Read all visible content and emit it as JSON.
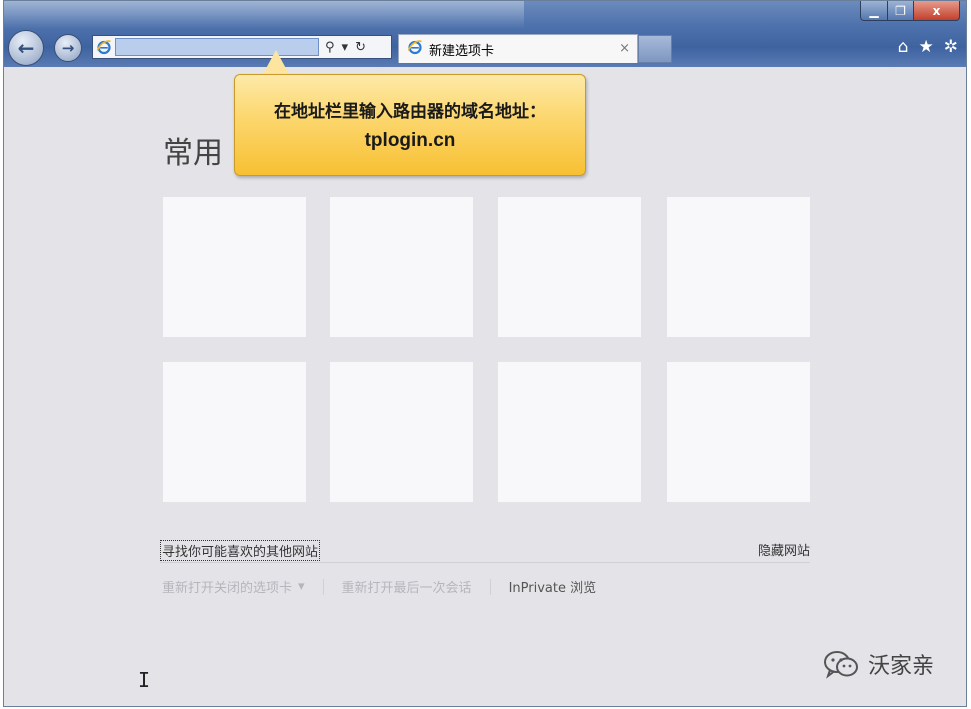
{
  "window": {
    "controls": {
      "minimize": "▁",
      "maximize": "❐",
      "close": "x"
    }
  },
  "nav": {
    "back_icon": "←",
    "forward_icon": "→"
  },
  "address": {
    "value": "",
    "search_icon": "⚲",
    "dropdown_icon": "▾",
    "refresh_icon": "↻"
  },
  "tab": {
    "label": "新建选项卡",
    "close": "×"
  },
  "toolbar_icons": {
    "home": "⌂",
    "favorites": "★",
    "tools": "✲"
  },
  "callout": {
    "line1": "在地址栏里输入路由器的域名地址：",
    "line2": "tplogin.cn"
  },
  "page": {
    "section_title": "常用",
    "find_sites_link": "寻找你可能喜欢的其他网站",
    "hide_sites_link": "隐藏网站",
    "reopen_closed_tabs": "重新打开关闭的选项卡",
    "reopen_dropdown": "▾",
    "reopen_last_session": "重新打开最后一次会话",
    "inprivate": "InPrivate 浏览"
  },
  "cursor": "I",
  "watermark": {
    "text": "沃家亲",
    "icon": "wechat-icon"
  },
  "colors": {
    "chrome": "#4f73ad",
    "content_bg": "#e4e4e8",
    "callout": "#fcd871",
    "tile": "#f8f8fa"
  }
}
